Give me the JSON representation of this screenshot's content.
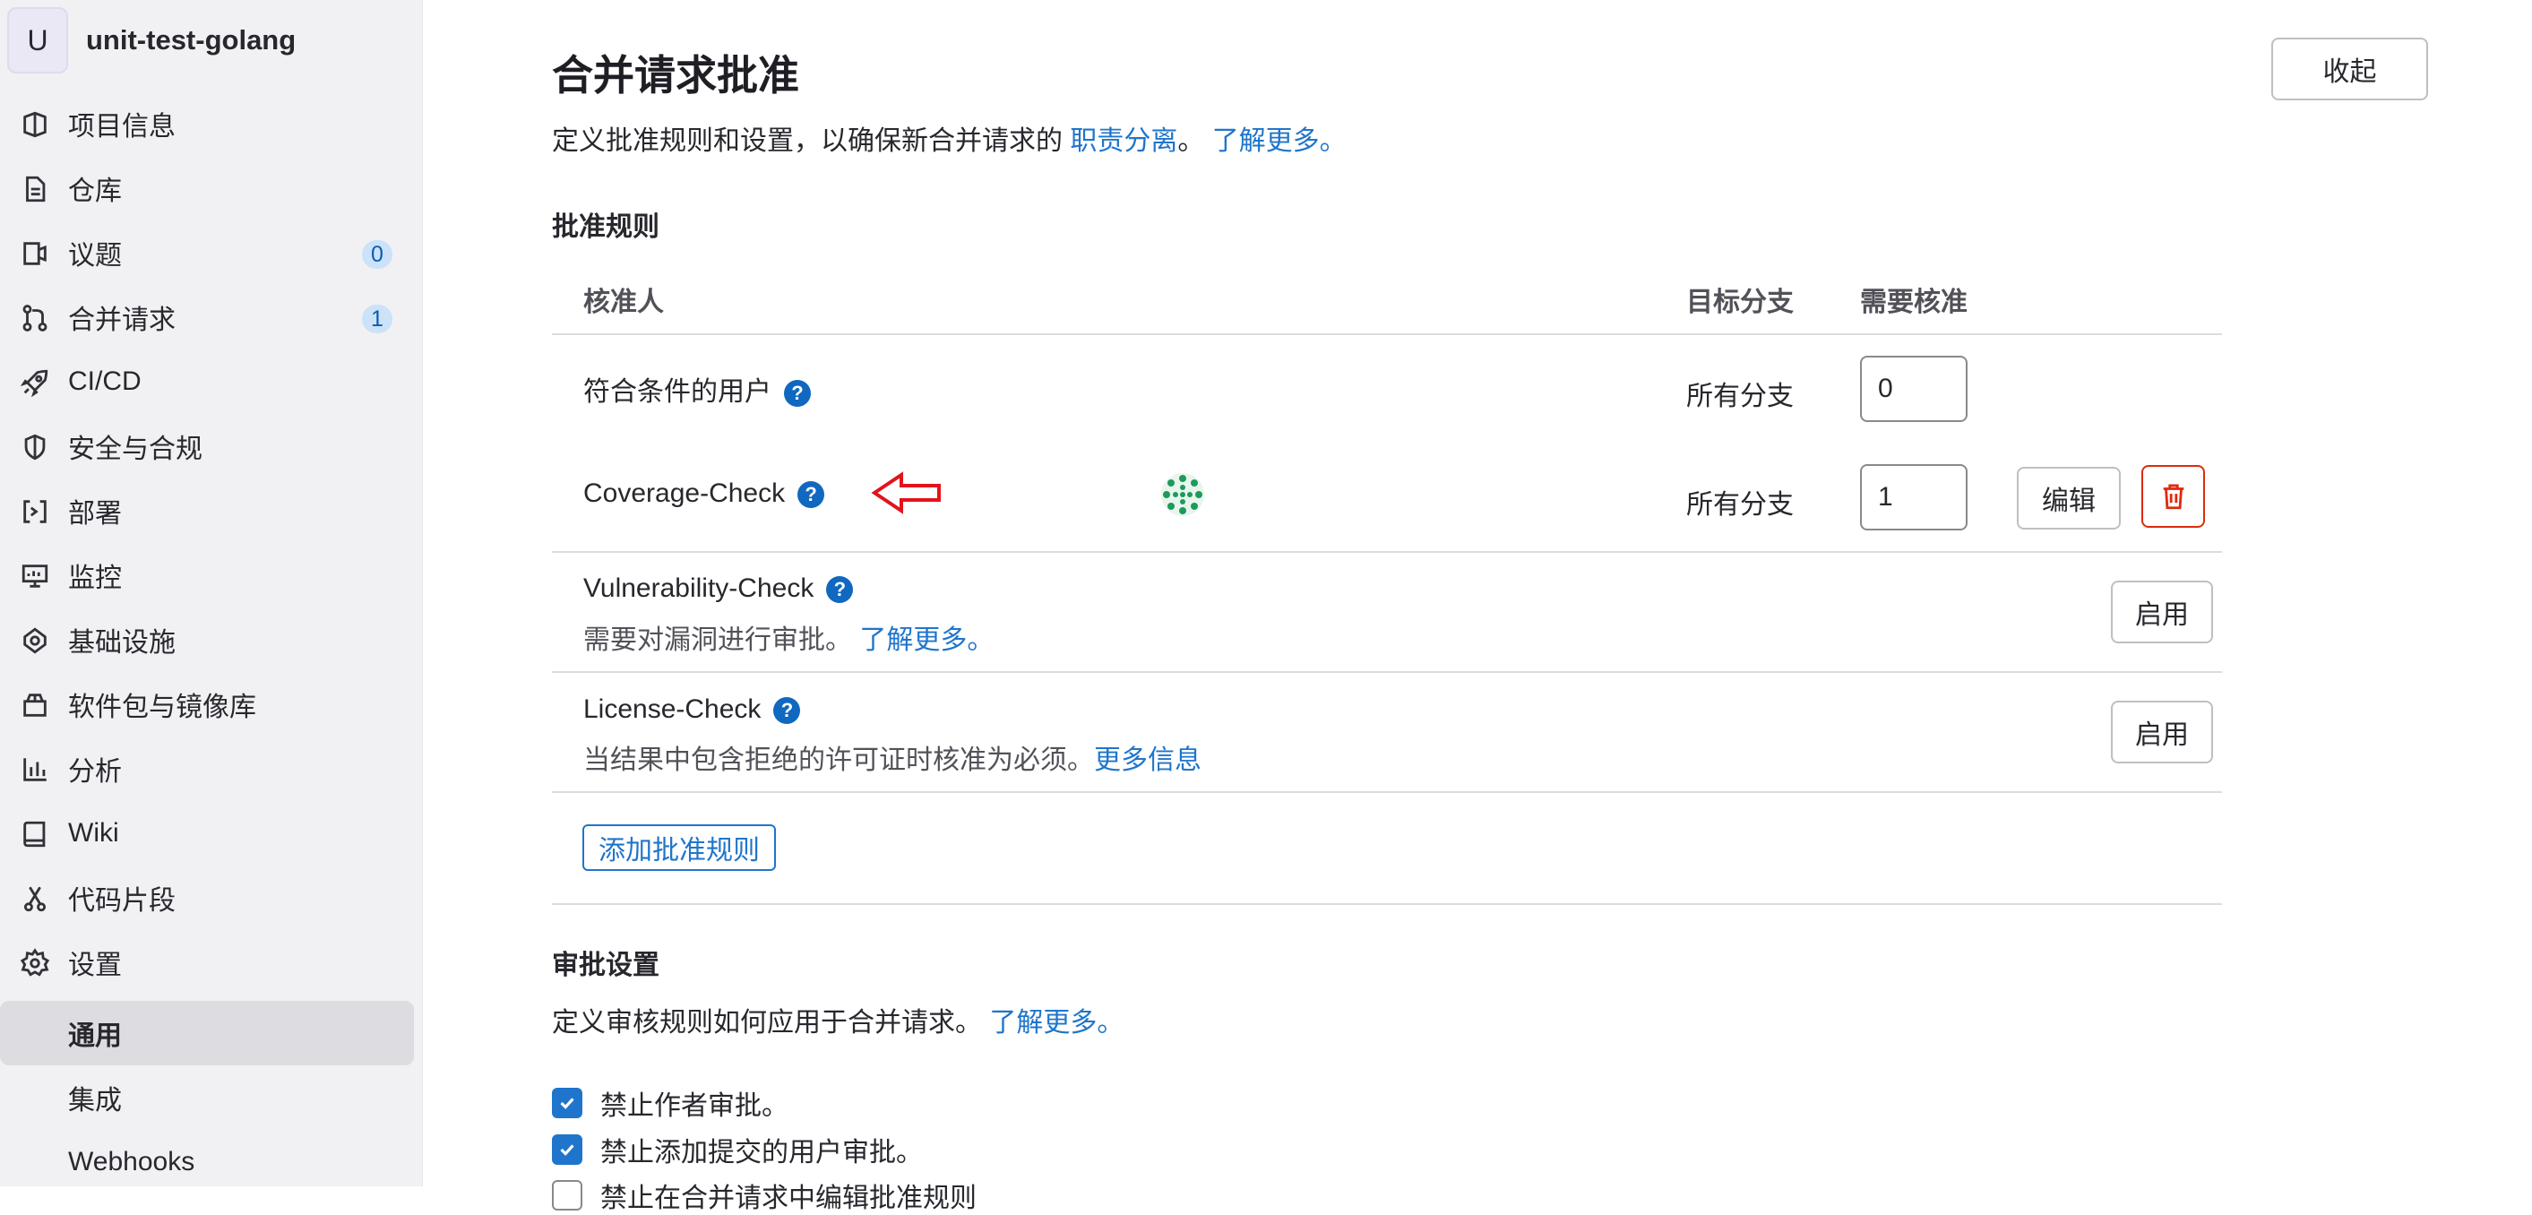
{
  "project": {
    "avatar_letter": "U",
    "name": "unit-test-golang"
  },
  "sidebar": {
    "items": [
      {
        "label": "项目信息",
        "icon": "project-icon"
      },
      {
        "label": "仓库",
        "icon": "doc-icon"
      },
      {
        "label": "议题",
        "icon": "issues-icon",
        "count": "0"
      },
      {
        "label": "合并请求",
        "icon": "merge-request-icon",
        "count": "1"
      },
      {
        "label": "CI/CD",
        "icon": "rocket-icon"
      },
      {
        "label": "安全与合规",
        "icon": "shield-icon"
      },
      {
        "label": "部署",
        "icon": "deployments-icon"
      },
      {
        "label": "监控",
        "icon": "monitor-icon"
      },
      {
        "label": "基础设施",
        "icon": "infrastructure-icon"
      },
      {
        "label": "软件包与镜像库",
        "icon": "package-icon"
      },
      {
        "label": "分析",
        "icon": "chart-icon"
      },
      {
        "label": "Wiki",
        "icon": "book-icon"
      },
      {
        "label": "代码片段",
        "icon": "snippet-icon"
      },
      {
        "label": "设置",
        "icon": "settings-icon"
      }
    ],
    "subitems": [
      {
        "label": "通用",
        "active": true
      },
      {
        "label": "集成"
      },
      {
        "label": "Webhooks"
      }
    ]
  },
  "page": {
    "title": "合并请求批准",
    "collapse_label": "收起",
    "desc_prefix": "定义批准规则和设置，以确保新合并请求的",
    "desc_link1": "职责分离",
    "desc_sep": "。",
    "desc_link2": "了解更多。"
  },
  "rules": {
    "heading": "批准规则",
    "col_approvers": "核准人",
    "col_branch": "目标分支",
    "col_required": "需要核准",
    "rows": [
      {
        "name": "符合条件的用户",
        "branch": "所有分支",
        "required": "0"
      },
      {
        "name": "Coverage-Check",
        "branch": "所有分支",
        "required": "1",
        "edit_label": "编辑"
      }
    ],
    "vulnerability": {
      "name": "Vulnerability-Check",
      "desc": "需要对漏洞进行审批。",
      "link": "了解更多。",
      "enable_label": "启用"
    },
    "license": {
      "name": "License-Check",
      "desc": "当结果中包含拒绝的许可证时核准为必须。",
      "link": "更多信息",
      "enable_label": "启用"
    },
    "add_rule_label": "添加批准规则"
  },
  "approval_settings": {
    "heading": "审批设置",
    "desc": "定义审核规则如何应用于合并请求。",
    "link": "了解更多。",
    "checkboxes": [
      {
        "label": "禁止作者审批。",
        "checked": true
      },
      {
        "label": "禁止添加提交的用户审批。",
        "checked": true
      },
      {
        "label": "禁止在合并请求中编辑批准规则",
        "checked": false
      }
    ]
  },
  "colors": {
    "link": "#1f75cb",
    "help": "#1068bf",
    "danger": "#dd2b0e",
    "annotation_arrow": "#e3131b"
  }
}
